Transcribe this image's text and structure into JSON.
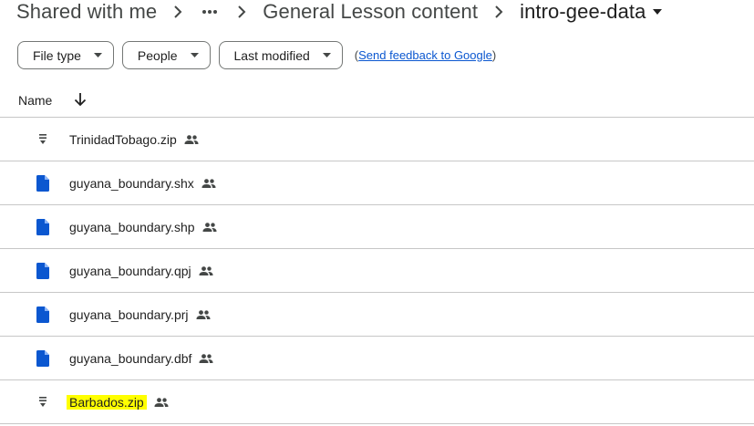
{
  "breadcrumb": {
    "root": "Shared with me",
    "more": "•••",
    "parent": "General Lesson content",
    "current": "intro-gee-data"
  },
  "filters": {
    "file_type": "File type",
    "people": "People",
    "last_modified": "Last modified",
    "feedback_prefix": "(",
    "feedback_link": "Send feedback to Google",
    "feedback_suffix": ")"
  },
  "list_header": {
    "name": "Name",
    "sort_icon": "arrow-down-icon"
  },
  "files": [
    {
      "name": "TrinidadTobago.zip",
      "icon": "zip-icon",
      "shared": true,
      "highlighted": false
    },
    {
      "name": "guyana_boundary.shx",
      "icon": "file-icon",
      "shared": true,
      "highlighted": false
    },
    {
      "name": "guyana_boundary.shp",
      "icon": "file-icon",
      "shared": true,
      "highlighted": false
    },
    {
      "name": "guyana_boundary.qpj",
      "icon": "file-icon",
      "shared": true,
      "highlighted": false
    },
    {
      "name": "guyana_boundary.prj",
      "icon": "file-icon",
      "shared": true,
      "highlighted": false
    },
    {
      "name": "guyana_boundary.dbf",
      "icon": "file-icon",
      "shared": true,
      "highlighted": false
    },
    {
      "name": "Barbados.zip",
      "icon": "zip-icon",
      "shared": true,
      "highlighted": true
    }
  ],
  "colors": {
    "file_icon": "#0b57d0",
    "zip_icon": "#444746",
    "highlight": "#ffff00",
    "link": "#0b57d0",
    "divider": "#c7c7c7"
  }
}
